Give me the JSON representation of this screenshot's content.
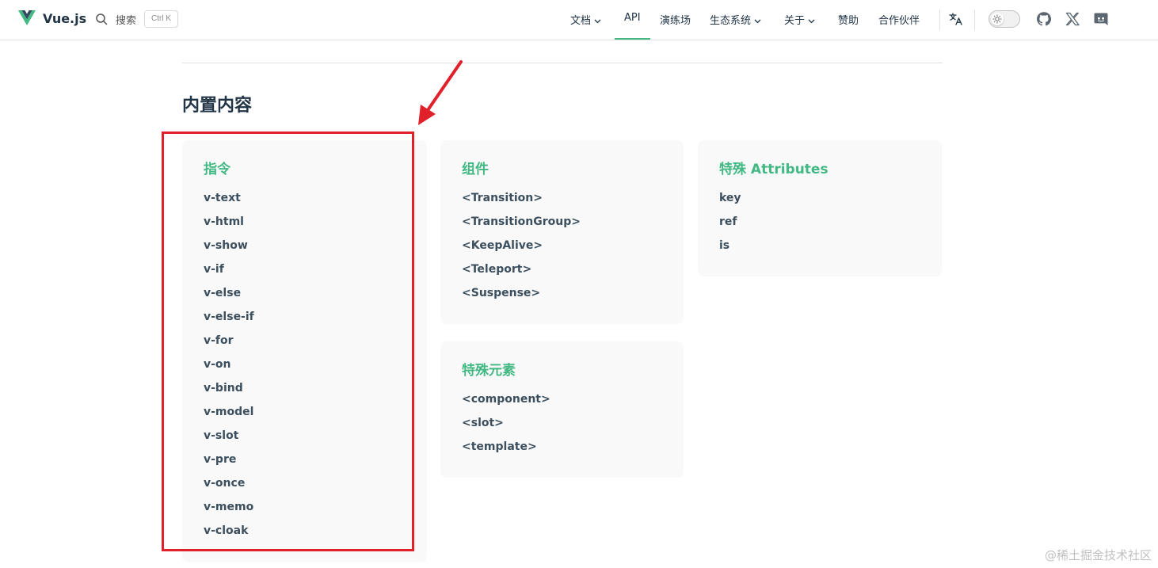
{
  "header": {
    "brand": "Vue.js",
    "search_label": "搜索",
    "search_shortcut": "Ctrl K",
    "nav": [
      {
        "label": "文档",
        "dropdown": true
      },
      {
        "label": "API",
        "dropdown": false,
        "active": true
      },
      {
        "label": "演练场",
        "dropdown": false
      },
      {
        "label": "生态系统",
        "dropdown": true
      },
      {
        "label": "关于",
        "dropdown": true
      },
      {
        "label": "赞助",
        "dropdown": false
      },
      {
        "label": "合作伙伴",
        "dropdown": false
      }
    ],
    "icons": [
      "translate-icon",
      "theme-toggle",
      "github-icon",
      "x-icon",
      "discord-icon"
    ]
  },
  "main": {
    "section_title": "内置内容",
    "cards": {
      "directives": {
        "title": "指令",
        "items": [
          "v-text",
          "v-html",
          "v-show",
          "v-if",
          "v-else",
          "v-else-if",
          "v-for",
          "v-on",
          "v-bind",
          "v-model",
          "v-slot",
          "v-pre",
          "v-once",
          "v-memo",
          "v-cloak"
        ]
      },
      "components": {
        "title": "组件",
        "items": [
          "<Transition>",
          "<TransitionGroup>",
          "<KeepAlive>",
          "<Teleport>",
          "<Suspense>"
        ]
      },
      "special_attributes": {
        "title": "特殊 Attributes",
        "items": [
          "key",
          "ref",
          "is"
        ]
      },
      "special_elements": {
        "title": "特殊元素",
        "items": [
          "<component>",
          "<slot>",
          "<template>"
        ]
      }
    }
  },
  "watermark": "@稀土掘金技术社区",
  "colors": {
    "accent": "#42b883",
    "text": "#213547",
    "card_bg": "#f9f9f9",
    "annotation_red": "#e0202a"
  }
}
